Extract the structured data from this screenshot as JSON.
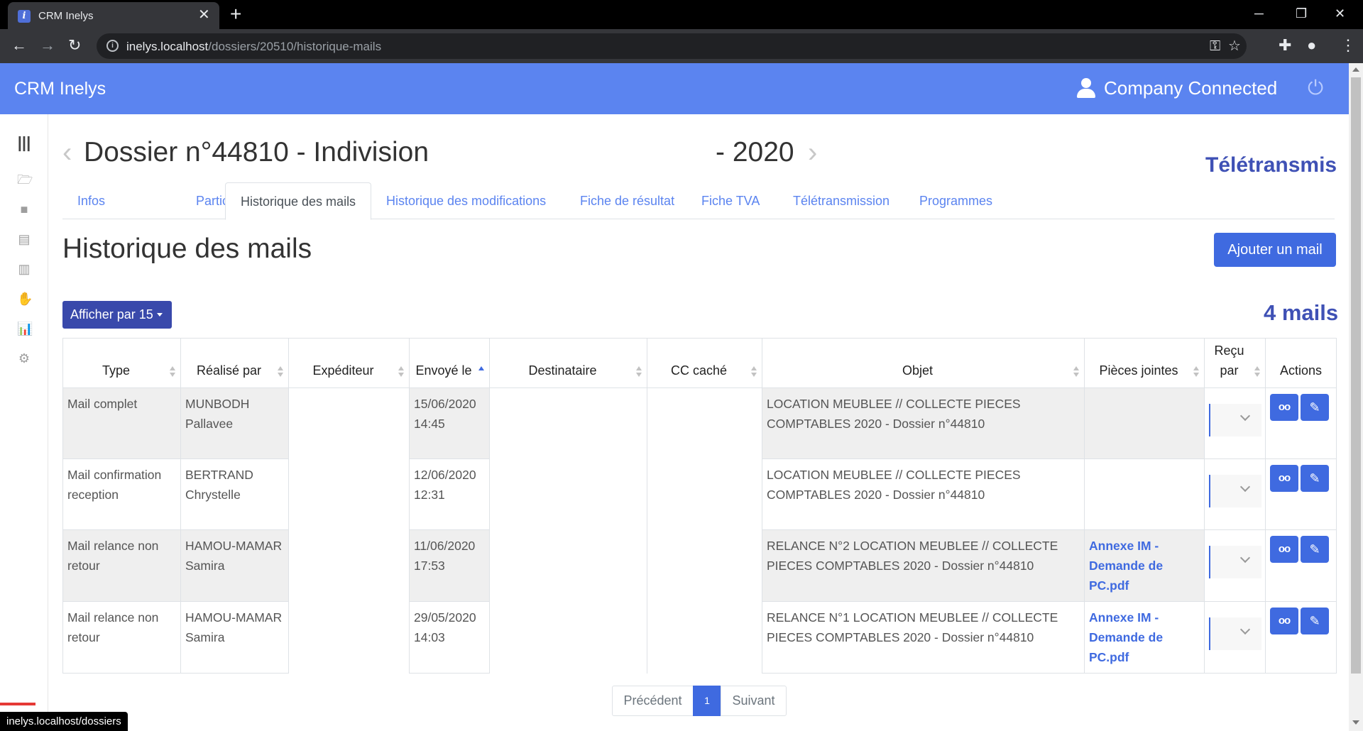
{
  "browser": {
    "tab_title": "CRM Inelys",
    "url_host": "inelys.localhost",
    "url_path": "/dossiers/20510/historique-mails",
    "status_url": "inelys.localhost/dossiers"
  },
  "header": {
    "brand": "CRM Inelys",
    "user": "Company Connected"
  },
  "sidebar": {
    "icons": [
      "menu-icon",
      "folder-open-icon",
      "folder-icon",
      "document-icon",
      "building-icon",
      "handshake-icon",
      "chart-icon",
      "gear-icon"
    ]
  },
  "dossier": {
    "title": "Dossier n°44810 - Indivision",
    "year": "- 2020",
    "teletransmis": "Télétransmis"
  },
  "tabs": [
    {
      "label": "Infos"
    },
    {
      "label": "Particularités"
    },
    {
      "label": "Historique des mails"
    },
    {
      "label": "Historique des modifications"
    },
    {
      "label": "Fiche de résultat"
    },
    {
      "label": "Fiche TVA"
    },
    {
      "label": "Télétransmission"
    },
    {
      "label": "Programmes"
    }
  ],
  "active_tab": "Historique des mails",
  "page": {
    "heading": "Historique des mails",
    "add_button": "Ajouter un mail",
    "per_page_button": "Afficher par 15",
    "count": "4 mails"
  },
  "table": {
    "columns": [
      "Type",
      "Réalisé par",
      "Expéditeur",
      "Envoyé le",
      "Destinataire",
      "CC caché",
      "Objet",
      "Pièces jointes",
      "Reçu par",
      "Actions"
    ],
    "rows": [
      {
        "type": "Mail complet",
        "realise_par": "MUNBODH Pallavee",
        "expediteur": "",
        "envoye_le": "15/06/2020 14:45",
        "destinataire": "",
        "cc_cache": "",
        "objet": "LOCATION MEUBLEE // COLLECTE PIECES COMPTABLES 2020 - Dossier n°44810",
        "pieces_jointes": ""
      },
      {
        "type": "Mail confirmation reception",
        "realise_par": "BERTRAND Chrystelle",
        "expediteur": "",
        "envoye_le": "12/06/2020 12:31",
        "destinataire": "",
        "cc_cache": "",
        "objet": "LOCATION MEUBLEE // COLLECTE PIECES COMPTABLES 2020 - Dossier n°44810",
        "pieces_jointes": ""
      },
      {
        "type": "Mail relance non retour",
        "realise_par": "HAMOU-MAMAR Samira",
        "expediteur": "",
        "envoye_le": "11/06/2020 17:53",
        "destinataire": "",
        "cc_cache": "",
        "objet": "RELANCE N°2 LOCATION MEUBLEE // COLLECTE PIECES COMPTABLES 2020 - Dossier n°44810",
        "pieces_jointes": "Annexe IM - Demande de PC.pdf"
      },
      {
        "type": "Mail relance non retour",
        "realise_par": "HAMOU-MAMAR Samira",
        "expediteur": "",
        "envoye_le": "29/05/2020 14:03",
        "destinataire": "",
        "cc_cache": "",
        "objet": "RELANCE N°1 LOCATION MEUBLEE // COLLECTE PIECES COMPTABLES 2020 - Dossier n°44810",
        "pieces_jointes": "Annexe IM - Demande de PC.pdf"
      }
    ]
  },
  "pagination": {
    "prev": "Précédent",
    "current": "1",
    "next": "Suivant"
  },
  "colors": {
    "header_bg": "#5b84f0",
    "primary": "#3f6ae0",
    "indigo": "#3f51b5"
  }
}
